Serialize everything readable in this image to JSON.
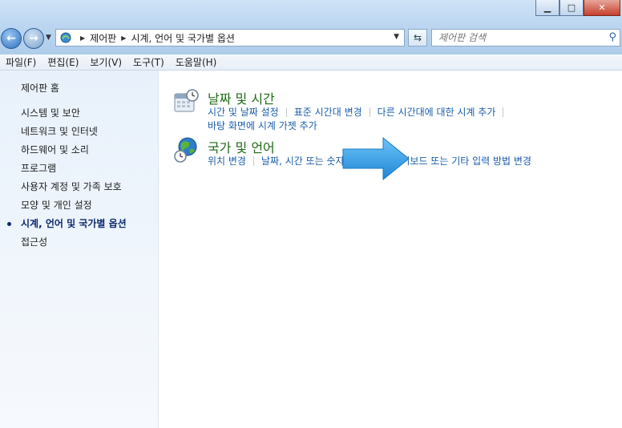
{
  "window": {
    "controls": {
      "minimize": "▁",
      "maximize": "□",
      "close": "✕"
    }
  },
  "address_bar": {
    "crumbs": [
      "제어판",
      "시계, 언어 및 국가별 옵션"
    ]
  },
  "search": {
    "placeholder": "제어판 검색"
  },
  "menu": [
    "파일(F)",
    "편집(E)",
    "보기(V)",
    "도구(T)",
    "도움말(H)"
  ],
  "sidebar": {
    "home": "제어판 홈",
    "items": [
      {
        "label": "시스템 및 보안"
      },
      {
        "label": "네트워크 및 인터넷"
      },
      {
        "label": "하드웨어 및 소리"
      },
      {
        "label": "프로그램"
      },
      {
        "label": "사용자 계정 및 가족 보호"
      },
      {
        "label": "모양 및 개인 설정"
      },
      {
        "label": "시계, 언어 및 국가별 옵션",
        "current": true
      },
      {
        "label": "접근성"
      }
    ]
  },
  "categories": [
    {
      "title": "날짜 및 시간",
      "icon": "calendar-clock-icon",
      "links": [
        "시간 및 날짜 설정",
        "표준 시간대 변경",
        "다른 시간대에 대한 시계 추가",
        "바탕 화면에 시계 가젯 추가"
      ]
    },
    {
      "title": "국가 및 언어",
      "icon": "globe-clock-icon",
      "links": [
        "위치 변경",
        "날짜, 시간 또는 숫자 형식 변경",
        "키보드 또는 기타 입력 방법 변경"
      ]
    }
  ],
  "colors": {
    "category_title": "#1e6a14",
    "link": "#1a5dab",
    "arrow": "#2f9ae6"
  }
}
